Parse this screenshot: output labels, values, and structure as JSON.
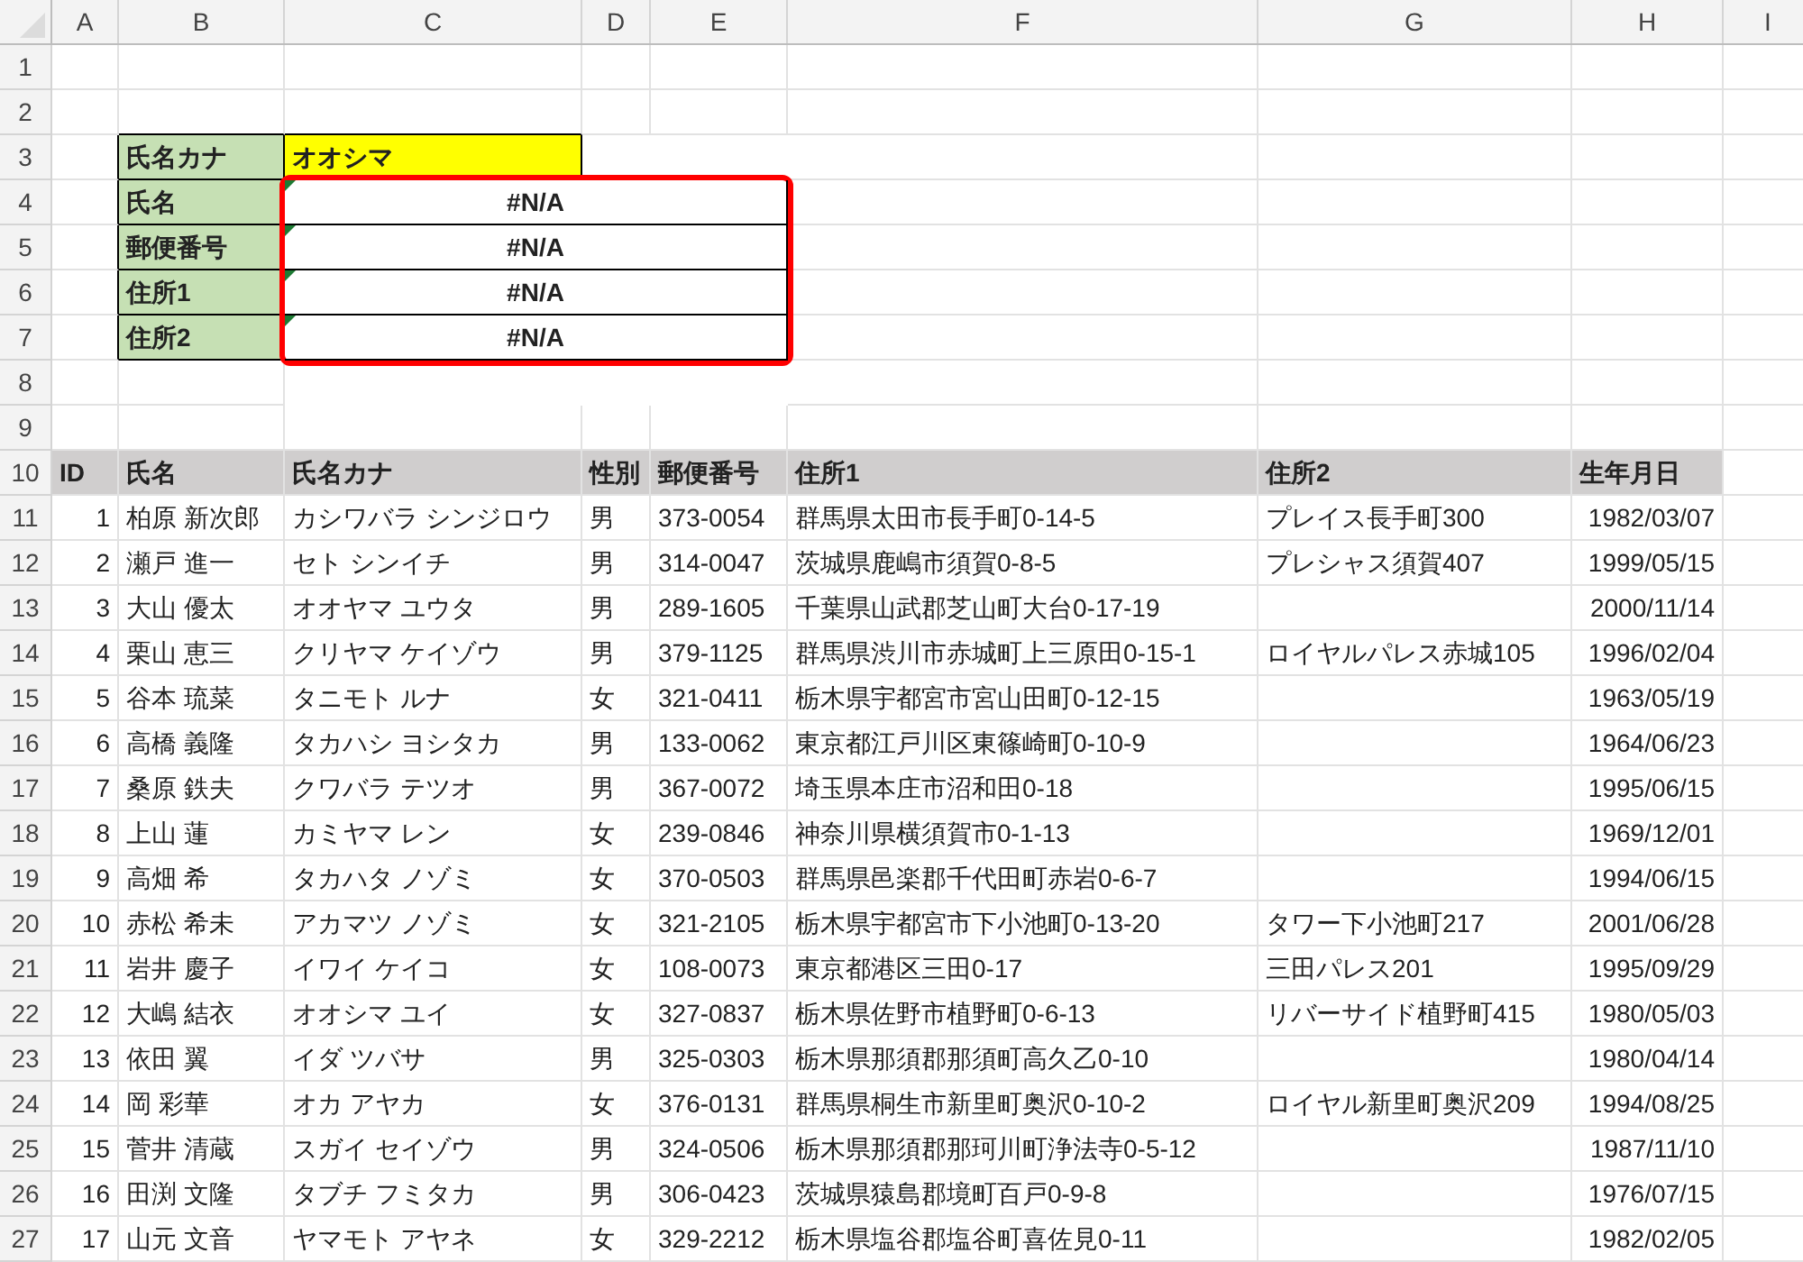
{
  "column_headers": [
    "A",
    "B",
    "C",
    "D",
    "E",
    "F",
    "G",
    "H",
    "I"
  ],
  "row_numbers": [
    "1",
    "2",
    "3",
    "4",
    "5",
    "6",
    "7",
    "8",
    "9",
    "10",
    "11",
    "12",
    "13",
    "14",
    "15",
    "16",
    "17",
    "18",
    "19",
    "20",
    "21",
    "22",
    "23",
    "24",
    "25",
    "26",
    "27"
  ],
  "lookup": {
    "key_label": "氏名カナ",
    "key_value": "オオシマ",
    "highlighted": true,
    "fields": [
      {
        "label": "氏名",
        "value": "#N/A",
        "flagged": true
      },
      {
        "label": "郵便番号",
        "value": "#N/A",
        "flagged": true
      },
      {
        "label": "住所1",
        "value": "#N/A",
        "flagged": true
      },
      {
        "label": "住所2",
        "value": "#N/A",
        "flagged": true
      }
    ]
  },
  "table": {
    "columns": [
      "ID",
      "氏名",
      "氏名カナ",
      "性別",
      "郵便番号",
      "住所1",
      "住所2",
      "生年月日"
    ],
    "rows": [
      [
        "1",
        "柏原 新次郎",
        "カシワバラ シンジロウ",
        "男",
        "373-0054",
        "群馬県太田市長手町0-14-5",
        "プレイス長手町300",
        "1982/03/07"
      ],
      [
        "2",
        "瀬戸 進一",
        "セト シンイチ",
        "男",
        "314-0047",
        "茨城県鹿嶋市須賀0-8-5",
        "プレシャス須賀407",
        "1999/05/15"
      ],
      [
        "3",
        "大山 優太",
        "オオヤマ ユウタ",
        "男",
        "289-1605",
        "千葉県山武郡芝山町大台0-17-19",
        "",
        "2000/11/14"
      ],
      [
        "4",
        "栗山 恵三",
        "クリヤマ ケイゾウ",
        "男",
        "379-1125",
        "群馬県渋川市赤城町上三原田0-15-1",
        "ロイヤルパレス赤城105",
        "1996/02/04"
      ],
      [
        "5",
        "谷本 琉菜",
        "タニモト ルナ",
        "女",
        "321-0411",
        "栃木県宇都宮市宮山田町0-12-15",
        "",
        "1963/05/19"
      ],
      [
        "6",
        "高橋 義隆",
        "タカハシ ヨシタカ",
        "男",
        "133-0062",
        "東京都江戸川区東篠崎町0-10-9",
        "",
        "1964/06/23"
      ],
      [
        "7",
        "桑原 鉄夫",
        "クワバラ テツオ",
        "男",
        "367-0072",
        "埼玉県本庄市沼和田0-18",
        "",
        "1995/06/15"
      ],
      [
        "8",
        "上山 蓮",
        "カミヤマ レン",
        "女",
        "239-0846",
        "神奈川県横須賀市0-1-13",
        "",
        "1969/12/01"
      ],
      [
        "9",
        "高畑 希",
        "タカハタ ノゾミ",
        "女",
        "370-0503",
        "群馬県邑楽郡千代田町赤岩0-6-7",
        "",
        "1994/06/15"
      ],
      [
        "10",
        "赤松 希未",
        "アカマツ ノゾミ",
        "女",
        "321-2105",
        "栃木県宇都宮市下小池町0-13-20",
        "タワー下小池町217",
        "2001/06/28"
      ],
      [
        "11",
        "岩井 慶子",
        "イワイ ケイコ",
        "女",
        "108-0073",
        "東京都港区三田0-17",
        "三田パレス201",
        "1995/09/29"
      ],
      [
        "12",
        "大嶋 結衣",
        "オオシマ ユイ",
        "女",
        "327-0837",
        "栃木県佐野市植野町0-6-13",
        "リバーサイド植野町415",
        "1980/05/03"
      ],
      [
        "13",
        "依田 翼",
        "イダ ツバサ",
        "男",
        "325-0303",
        "栃木県那須郡那須町高久乙0-10",
        "",
        "1980/04/14"
      ],
      [
        "14",
        "岡 彩華",
        "オカ アヤカ",
        "女",
        "376-0131",
        "群馬県桐生市新里町奥沢0-10-2",
        "ロイヤル新里町奥沢209",
        "1994/08/25"
      ],
      [
        "15",
        "菅井 清蔵",
        "スガイ セイゾウ",
        "男",
        "324-0506",
        "栃木県那須郡那珂川町浄法寺0-5-12",
        "",
        "1987/11/10"
      ],
      [
        "16",
        "田渕 文隆",
        "タブチ フミタカ",
        "男",
        "306-0423",
        "茨城県猿島郡境町百戸0-9-8",
        "",
        "1976/07/15"
      ],
      [
        "17",
        "山元 文音",
        "ヤマモト アヤネ",
        "女",
        "329-2212",
        "栃木県塩谷郡塩谷町喜佐見0-11",
        "",
        "1982/02/05"
      ]
    ]
  }
}
